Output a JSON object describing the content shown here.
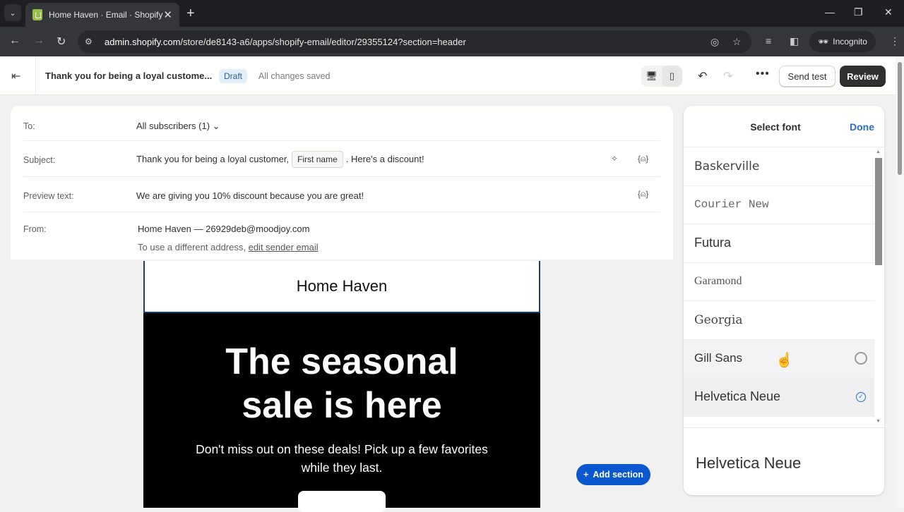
{
  "browser": {
    "tab_title": "Home Haven · Email · Shopify",
    "url_host": "admin.shopify.com",
    "url_path": "/store/de8143-a6/apps/shopify-email/editor/29355124?section=header",
    "incognito_label": "Incognito"
  },
  "header": {
    "email_title": "Thank you for being a loyal custome...",
    "status_badge": "Draft",
    "save_status": "All changes saved",
    "send_test_label": "Send test",
    "review_label": "Review",
    "more_label": "•••"
  },
  "meta": {
    "to_label": "To:",
    "to_value": "All subscribers (1)",
    "subject_label": "Subject:",
    "subject_prefix": "Thank you for being a loyal customer,",
    "subject_chip": "First name",
    "subject_suffix": ". Here's a discount!",
    "preview_label": "Preview text:",
    "preview_value": "We are giving you 10% discount because you are great!",
    "from_label": "From:",
    "from_value": "Home Haven — 26929deb@moodjoy.com",
    "from_note": "To use a different address,",
    "from_link": "edit sender email"
  },
  "email": {
    "store_name": "Home Haven",
    "hero_title_line1": "The seasonal",
    "hero_title_line2": "sale is here",
    "hero_text_line1": "Don't miss out on these deals! Pick up a few favorites",
    "hero_text_line2": "while they last."
  },
  "add_section_label": "Add section",
  "font_panel": {
    "title": "Select font",
    "done_label": "Done",
    "fonts": [
      {
        "name": "Baskerville",
        "state": "none"
      },
      {
        "name": "Courier New",
        "state": "none"
      },
      {
        "name": "Futura",
        "state": "none"
      },
      {
        "name": "Garamond",
        "state": "none"
      },
      {
        "name": "Georgia",
        "state": "none"
      },
      {
        "name": "Gill Sans",
        "state": "hover"
      },
      {
        "name": "Helvetica Neue",
        "state": "selected"
      }
    ],
    "preview_label": "Helvetica Neue"
  },
  "colors": {
    "primary_blue": "#0b57d0",
    "done_link": "#2a6fbf",
    "review_button": "#303030"
  }
}
